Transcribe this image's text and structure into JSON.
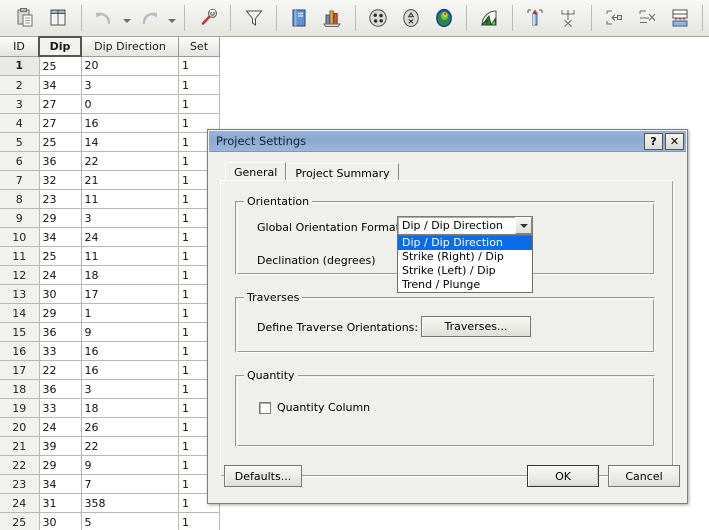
{
  "toolbar": {
    "buttons": [
      {
        "name": "paste-icon",
        "title": "Paste"
      },
      {
        "name": "columns-icon",
        "title": "Columns"
      },
      {
        "name": "undo-icon",
        "title": "Undo"
      },
      {
        "name": "undo-dropdown-arrow-icon",
        "title": "Undo History"
      },
      {
        "name": "redo-icon",
        "title": "Redo"
      },
      {
        "name": "redo-dropdown-arrow-icon",
        "title": "Redo History"
      },
      {
        "name": "wrench-icon",
        "title": "Project Settings"
      },
      {
        "name": "filter-funnel-icon",
        "title": "Filter Data"
      },
      {
        "name": "book-icon",
        "title": "Info Viewer"
      },
      {
        "name": "bar-chart-icon",
        "title": "Chart"
      },
      {
        "name": "scatter-plot-icon",
        "title": "Scatter Plot"
      },
      {
        "name": "symbolic-plot-icon",
        "title": "Symbolic Plot"
      },
      {
        "name": "contour-sphere-icon",
        "title": "Contour Plot"
      },
      {
        "name": "rosette-icon",
        "title": "Rosette Plot"
      },
      {
        "name": "add-column-icon",
        "title": "Add Column"
      },
      {
        "name": "delete-column-icon",
        "title": "Delete Column"
      },
      {
        "name": "insert-row-icon",
        "title": "Insert Row"
      },
      {
        "name": "delete-row-icon",
        "title": "Delete Row"
      },
      {
        "name": "append-rows-icon",
        "title": "Append Rows"
      }
    ]
  },
  "grid": {
    "columns": [
      "ID",
      "Dip",
      "Dip Direction",
      "Set"
    ],
    "selected_column": "Dip",
    "selected_row_index": 0,
    "rows": [
      [
        "1",
        "25",
        "20",
        "1"
      ],
      [
        "2",
        "34",
        "3",
        "1"
      ],
      [
        "3",
        "27",
        "0",
        "1"
      ],
      [
        "4",
        "27",
        "16",
        "1"
      ],
      [
        "5",
        "25",
        "14",
        "1"
      ],
      [
        "6",
        "36",
        "22",
        "1"
      ],
      [
        "7",
        "32",
        "21",
        "1"
      ],
      [
        "8",
        "23",
        "11",
        "1"
      ],
      [
        "9",
        "29",
        "3",
        "1"
      ],
      [
        "10",
        "34",
        "24",
        "1"
      ],
      [
        "11",
        "25",
        "11",
        "1"
      ],
      [
        "12",
        "24",
        "18",
        "1"
      ],
      [
        "13",
        "30",
        "17",
        "1"
      ],
      [
        "14",
        "29",
        "1",
        "1"
      ],
      [
        "15",
        "36",
        "9",
        "1"
      ],
      [
        "16",
        "33",
        "16",
        "1"
      ],
      [
        "17",
        "22",
        "16",
        "1"
      ],
      [
        "18",
        "36",
        "3",
        "1"
      ],
      [
        "19",
        "33",
        "18",
        "1"
      ],
      [
        "20",
        "24",
        "26",
        "1"
      ],
      [
        "21",
        "39",
        "22",
        "1"
      ],
      [
        "22",
        "29",
        "9",
        "1"
      ],
      [
        "23",
        "34",
        "7",
        "1"
      ],
      [
        "24",
        "31",
        "358",
        "1"
      ],
      [
        "25",
        "30",
        "5",
        "1"
      ]
    ]
  },
  "dialog": {
    "title": "Project Settings",
    "help_button": "?",
    "close_button": "✕",
    "tabs": [
      {
        "label": "General",
        "active": true
      },
      {
        "label": "Project Summary",
        "active": false
      }
    ],
    "orientation": {
      "group_label": "Orientation",
      "format_label": "Global Orientation Format",
      "format_value": "Dip / Dip Direction",
      "format_options": [
        "Dip / Dip Direction",
        "Strike (Right) / Dip",
        "Strike (Left) / Dip",
        "Trend / Plunge"
      ],
      "selected_option_index": 0,
      "declination_label": "Declination (degrees)"
    },
    "traverses": {
      "group_label": "Traverses",
      "define_label": "Define Traverse Orientations:",
      "button_label": "Traverses..."
    },
    "quantity": {
      "group_label": "Quantity",
      "checkbox_label": "Quantity Column",
      "checked": false
    },
    "footer": {
      "defaults_label": "Defaults...",
      "ok_label": "OK",
      "cancel_label": "Cancel"
    }
  },
  "colors": {
    "titlebar": "#8aa9d0",
    "highlight": "#0a6ce8",
    "dialog_face": "#efefeb",
    "toolbar_face": "#eeeeea"
  }
}
